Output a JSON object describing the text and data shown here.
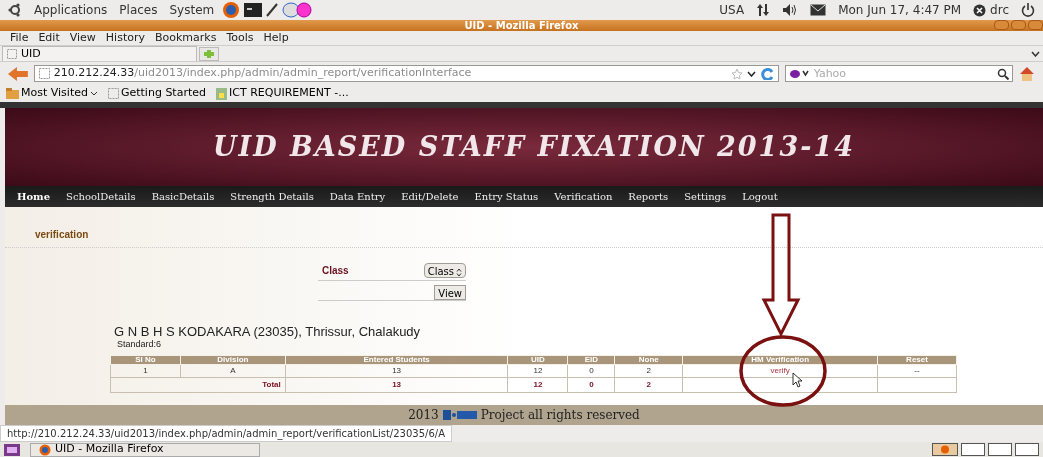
{
  "top_panel": {
    "menus": [
      "Applications",
      "Places",
      "System"
    ],
    "keyboard": "USA",
    "clock": "Mon Jun 17,  4:47 PM",
    "user": "drc"
  },
  "window": {
    "title": "UID - Mozilla Firefox"
  },
  "menubar": [
    "File",
    "Edit",
    "View",
    "History",
    "Bookmarks",
    "Tools",
    "Help"
  ],
  "tabs": [
    {
      "label": "UID",
      "selected": true
    }
  ],
  "address": {
    "host": "210.212.24.33",
    "path": "/uid2013/index.php/admin/admin_report/verificationInterface"
  },
  "search": {
    "placeholder": "Yahoo"
  },
  "bookmarks": [
    "Most Visited",
    "Getting Started",
    "ICT REQUIREMENT -..."
  ],
  "banner": {
    "title": "UID BASED STAFF FIXATION 2013-14"
  },
  "nav": [
    {
      "label": "Home",
      "selected": true
    },
    {
      "label": "SchoolDetails",
      "selected": false
    },
    {
      "label": "BasicDetails",
      "selected": false
    },
    {
      "label": "Strength Details",
      "selected": false
    },
    {
      "label": "Data Entry",
      "selected": false
    },
    {
      "label": "Edit/Delete",
      "selected": false
    },
    {
      "label": "Entry Status",
      "selected": false
    },
    {
      "label": "Verification",
      "selected": false
    },
    {
      "label": "Reports",
      "selected": false
    },
    {
      "label": "Settings",
      "selected": false
    },
    {
      "label": "Logout",
      "selected": false
    }
  ],
  "section_title": "verification",
  "form": {
    "label": "Class",
    "select": "Class",
    "button": "View"
  },
  "school": "G N B H S KODAKARA (23035), Thrissur, Chalakudy",
  "standard": "Standard:6",
  "table": {
    "columns": [
      "Sl No",
      "Division",
      "Entered Students",
      "UID",
      "EID",
      "None",
      "HM Verification",
      "Reset"
    ],
    "rows": [
      [
        "1",
        "A",
        "13",
        "12",
        "0",
        "2",
        "verify",
        "--"
      ]
    ],
    "total": {
      "label": "Total",
      "values": [
        "13",
        "12",
        "0",
        "2"
      ]
    }
  },
  "footer": {
    "year": "2013",
    "text": "Project all rights reserved"
  },
  "status_bar": "http://210.212.24.33/uid2013/index.php/admin/admin_report/verificationList/23035/6/A",
  "taskbar": [
    {
      "label": "UID - Mozilla Firefox",
      "selected": false
    }
  ]
}
